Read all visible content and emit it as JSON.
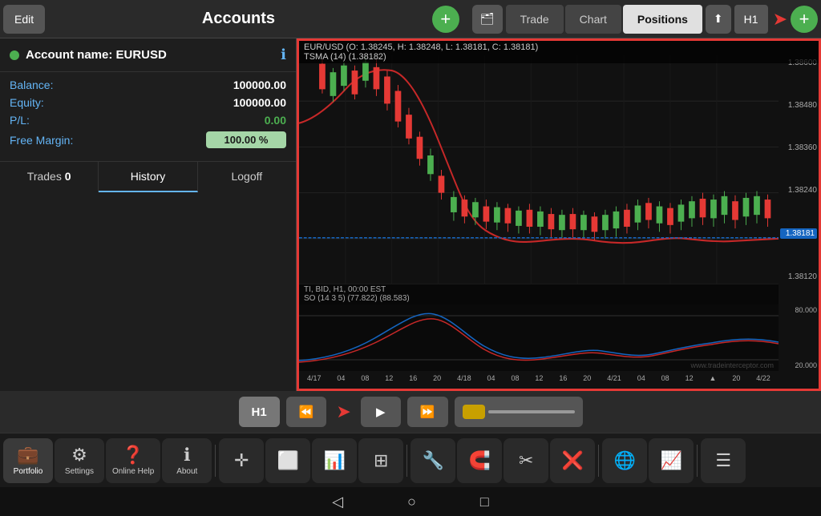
{
  "topBar": {
    "editLabel": "Edit",
    "title": "Accounts",
    "addIcon": "+",
    "portfolioIcon": "🗂",
    "tradeTab": "Trade",
    "chartTab": "Chart",
    "positionsTab": "Positions",
    "shareIcon": "share",
    "h1Label": "H1",
    "addIcon2": "+"
  },
  "account": {
    "name": "Account name: EURUSD",
    "balanceLabel": "Balance:",
    "balanceValue": "100000.00",
    "equityLabel": "Equity:",
    "equityValue": "100000.00",
    "plLabel": "P/L:",
    "plValue": "0.00",
    "freeMarginLabel": "Free Margin:",
    "freeMarginValue": "100.00 %"
  },
  "tabs": {
    "tradesLabel": "Trades",
    "tradesCount": "0",
    "historyLabel": "History",
    "logoffLabel": "Logoff"
  },
  "chart": {
    "infoLine1": "EUR/USD (O: 1.38245, H: 1.38248, L: 1.38181, C: 1.38181)",
    "infoLine2": "TSMA (14) (1.38182)",
    "infoLine3": "TI, BID, H1, 00:00 EST",
    "oscillatorLabel": "SO (14 3 5) (77.822) (88.583)",
    "highlightedPrice": "1.38181",
    "yLabels": [
      "1.38600",
      "1.38480",
      "1.38360",
      "1.38240",
      "1.38120"
    ],
    "xLabels": [
      "4/17",
      "04",
      "08",
      "12",
      "16",
      "20",
      "4/18",
      "04",
      "08",
      "12",
      "16",
      "20",
      "4/21",
      "04",
      "08",
      "12",
      "▲",
      "20",
      "4/22"
    ],
    "oscYLabels": [
      "80.000",
      "20.000"
    ],
    "watermark": "www.tradeinterceptor.com"
  },
  "controls": {
    "h1Label": "H1",
    "rewindIcon": "⏪",
    "playIcon": "▶",
    "fastForwardIcon": "⏩"
  },
  "bottomToolbar": {
    "items": [
      {
        "id": "portfolio",
        "label": "Portfolio",
        "icon": "💼",
        "active": true
      },
      {
        "id": "settings",
        "label": "Settings",
        "icon": "⚙"
      },
      {
        "id": "help",
        "label": "Online Help",
        "icon": "❓"
      },
      {
        "id": "about",
        "label": "About",
        "icon": "ℹ"
      },
      {
        "id": "crosshair",
        "label": "",
        "icon": "✛"
      },
      {
        "id": "frame",
        "label": "",
        "icon": "⬜"
      },
      {
        "id": "barchart",
        "label": "",
        "icon": "📊"
      },
      {
        "id": "grid",
        "label": "",
        "icon": "⊞"
      },
      {
        "id": "tools",
        "label": "",
        "icon": "🔧"
      },
      {
        "id": "magnet",
        "label": "",
        "icon": "🧲"
      },
      {
        "id": "scissors",
        "label": "",
        "icon": "✂"
      },
      {
        "id": "delete",
        "label": "",
        "icon": "❌"
      },
      {
        "id": "globe",
        "label": "",
        "icon": "🌐"
      },
      {
        "id": "chart2",
        "label": "",
        "icon": "📈"
      },
      {
        "id": "menu",
        "label": "",
        "icon": "☰"
      }
    ]
  },
  "androidNav": {
    "back": "◁",
    "home": "○",
    "recent": "□"
  }
}
